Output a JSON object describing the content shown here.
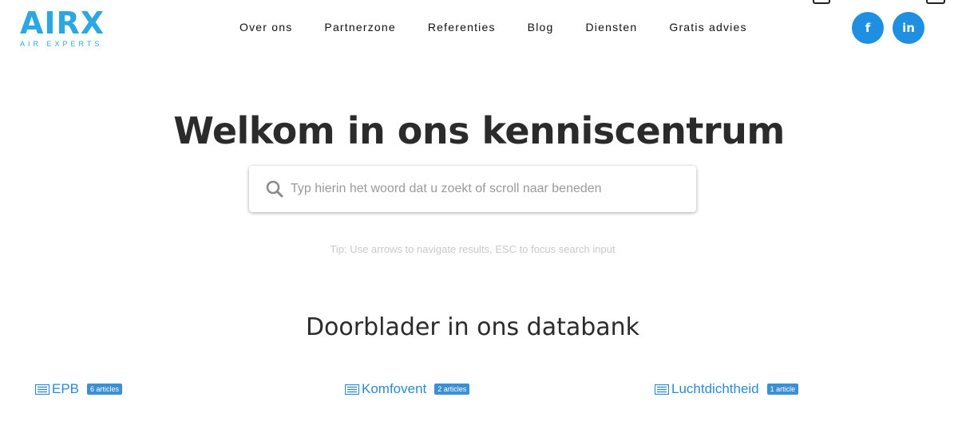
{
  "brand": {
    "name": "AIRX",
    "tagline": "AIR EXPERTS",
    "color": "#2ba7e3"
  },
  "nav": {
    "items": [
      {
        "label": "Over ons"
      },
      {
        "label": "Partnerzone"
      },
      {
        "label": "Referenties"
      },
      {
        "label": "Blog"
      },
      {
        "label": "Diensten"
      },
      {
        "label": "Gratis advies"
      }
    ]
  },
  "social": {
    "facebook": {
      "icon": "facebook-icon",
      "glyph": "f"
    },
    "linkedin": {
      "icon": "linkedin-icon",
      "glyph": "in"
    },
    "color": "#1e8fe1"
  },
  "hero": {
    "title": "Welkom in ons kenniscentrum"
  },
  "search": {
    "placeholder": "Typ hierin het woord dat u zoekt of scroll naar beneden",
    "value": "",
    "icon": "search-icon"
  },
  "tip": {
    "text": "Tip: Use arrows to navigate results, ESC to focus search input"
  },
  "database": {
    "title": "Doorblader in ons databank",
    "categories": [
      {
        "label": "EPB",
        "badge": "6 articles",
        "icon": "list-icon"
      },
      {
        "label": "Komfovent",
        "badge": "2 articles",
        "icon": "list-icon"
      },
      {
        "label": "Luchtdichtheid",
        "badge": "1 article",
        "icon": "list-icon"
      }
    ]
  }
}
